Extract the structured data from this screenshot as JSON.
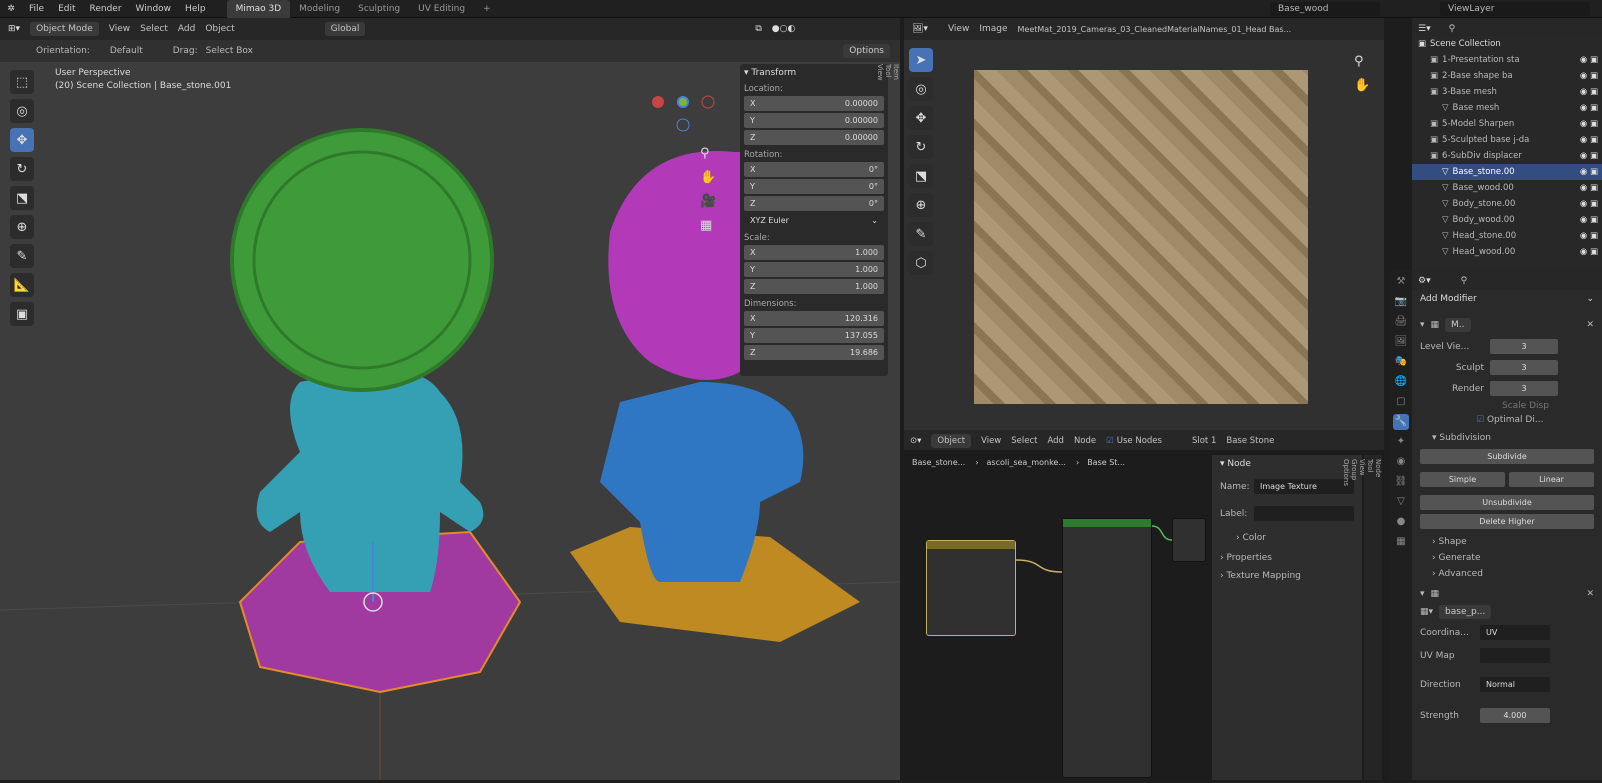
{
  "menu": [
    "File",
    "Edit",
    "Render",
    "Window",
    "Help"
  ],
  "workspaces": [
    "Mimao 3D",
    "Modeling",
    "Sculpting",
    "UV Editing",
    "+"
  ],
  "scene_field": "Base_wood",
  "view_layer": "ViewLayer",
  "vp_header": {
    "mode": "Object Mode",
    "view": "View",
    "select": "Select",
    "add": "Add",
    "object": "Object",
    "transform": "Global"
  },
  "vp_sub": {
    "orientation": "Orientation:",
    "orient_val": "Default",
    "drag": "Drag:",
    "drag_val": "Select Box",
    "options": "Options"
  },
  "vp_info": {
    "line1": "User Perspective",
    "line2": "(20) Scene Collection | Base_stone.001"
  },
  "npanel": {
    "title": "Transform",
    "location": "Location:",
    "loc": [
      {
        "a": "X",
        "v": "0.00000"
      },
      {
        "a": "Y",
        "v": "0.00000"
      },
      {
        "a": "Z",
        "v": "0.00000"
      }
    ],
    "rotation": "Rotation:",
    "rot": [
      {
        "a": "X",
        "v": "0°"
      },
      {
        "a": "Y",
        "v": "0°"
      },
      {
        "a": "Z",
        "v": "0°"
      }
    ],
    "euler": "XYZ Euler",
    "scale": "Scale:",
    "sc": [
      {
        "a": "X",
        "v": "1.000"
      },
      {
        "a": "Y",
        "v": "1.000"
      },
      {
        "a": "Z",
        "v": "1.000"
      }
    ],
    "dimensions": "Dimensions:",
    "dim": [
      {
        "a": "X",
        "v": "120.316"
      },
      {
        "a": "Y",
        "v": "137.055"
      },
      {
        "a": "Z",
        "v": "19.686"
      }
    ],
    "tabs": [
      "Item",
      "Tool",
      "View"
    ]
  },
  "img_header": {
    "view": "View",
    "image": "Image",
    "name": "MeetMat_2019_Cameras_03_CleanedMaterialNames_01_Head Bas..."
  },
  "node_header": {
    "object": "Object",
    "view": "View",
    "select": "Select",
    "add": "Add",
    "node": "Node",
    "use_nodes": "Use Nodes",
    "slot": "Slot 1",
    "material": "Base Stone"
  },
  "breadcrumb": [
    "Base_stone...",
    "ascoli_sea_monke...",
    "Base St..."
  ],
  "node_panel": {
    "title": "Node",
    "name_lbl": "Name:",
    "name_val": "Image Texture",
    "label_lbl": "Label:",
    "color": "Color",
    "properties": "Properties",
    "texture_mapping": "Texture Mapping",
    "tabs": [
      "Node",
      "Tool",
      "View",
      "Group",
      "Options"
    ]
  },
  "outliner": {
    "title": "Scene Collection",
    "items": [
      {
        "t": "1-Presentation sta",
        "ind": 1
      },
      {
        "t": "2-Base shape ba",
        "ind": 1
      },
      {
        "t": "3-Base mesh",
        "ind": 1
      },
      {
        "t": "Base mesh",
        "ind": 2
      },
      {
        "t": "5-Model Sharpen",
        "ind": 1
      },
      {
        "t": "5-Sculpted base j-da",
        "ind": 1
      },
      {
        "t": "6-SubDiv displacer",
        "ind": 1
      },
      {
        "t": "Base_stone.00",
        "ind": 2,
        "sel": true
      },
      {
        "t": "Base_wood.00",
        "ind": 2
      },
      {
        "t": "Body_stone.00",
        "ind": 2
      },
      {
        "t": "Body_wood.00",
        "ind": 2
      },
      {
        "t": "Head_stone.00",
        "ind": 2
      },
      {
        "t": "Head_wood.00",
        "ind": 2
      }
    ]
  },
  "props": {
    "add_modifier": "Add Modifier",
    "mod_name": "M..",
    "level_view": "Level Vie...",
    "level_view_v": "3",
    "sculpt": "Sculpt",
    "sculpt_v": "3",
    "render": "Render",
    "render_v": "3",
    "scale_disp": "Scale Disp",
    "optimal": "Optimal Di...",
    "subdivision": "Subdivision",
    "subdivide": "Subdivide",
    "simple": "Simple",
    "linear": "Linear",
    "unsubdivide": "Unsubdivide",
    "delete_higher": "Delete Higher",
    "shape": "Shape",
    "generate": "Generate",
    "advanced": "Advanced",
    "tex_name": "base_p...",
    "coords": "Coordina...",
    "coords_v": "UV",
    "uvmap": "UV Map",
    "direction": "Direction",
    "direction_v": "Normal",
    "strength": "Strength",
    "strength_v": "4.000"
  }
}
